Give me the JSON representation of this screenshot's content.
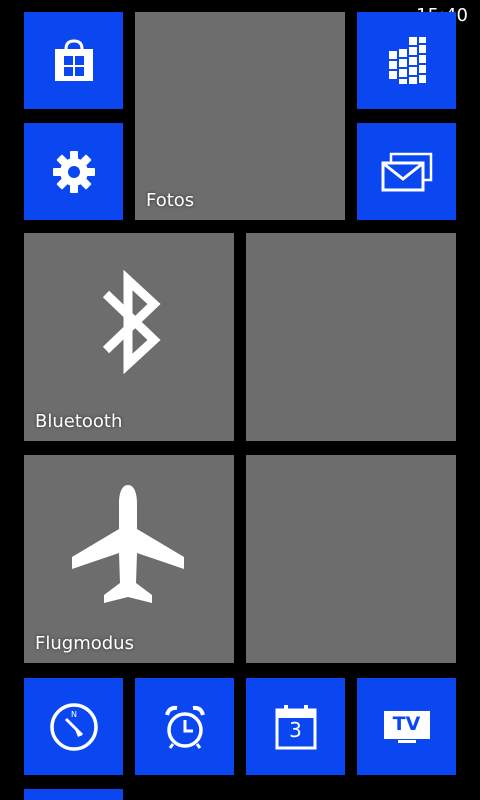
{
  "status_bar": {
    "time": "15:40"
  },
  "tiles": {
    "store": {
      "icon": "store-bag-icon"
    },
    "fotos": {
      "label": "Fotos",
      "icon": ""
    },
    "office": {
      "icon": "office-grid-icon"
    },
    "settings": {
      "icon": "gear-icon"
    },
    "messaging": {
      "icon": "envelope-icon"
    },
    "bluetooth": {
      "label": "Bluetooth",
      "icon": "bluetooth-icon"
    },
    "flugmodus": {
      "label": "Flugmodus",
      "icon": "airplane-icon"
    },
    "compass": {
      "icon": "compass-icon"
    },
    "alarm": {
      "icon": "alarm-clock-icon"
    },
    "calendar": {
      "icon": "calendar-icon",
      "day": "3"
    },
    "tv": {
      "icon": "tv-icon",
      "text": "TV"
    }
  },
  "colors": {
    "accent": "#0a47f0",
    "background": "#000000"
  }
}
